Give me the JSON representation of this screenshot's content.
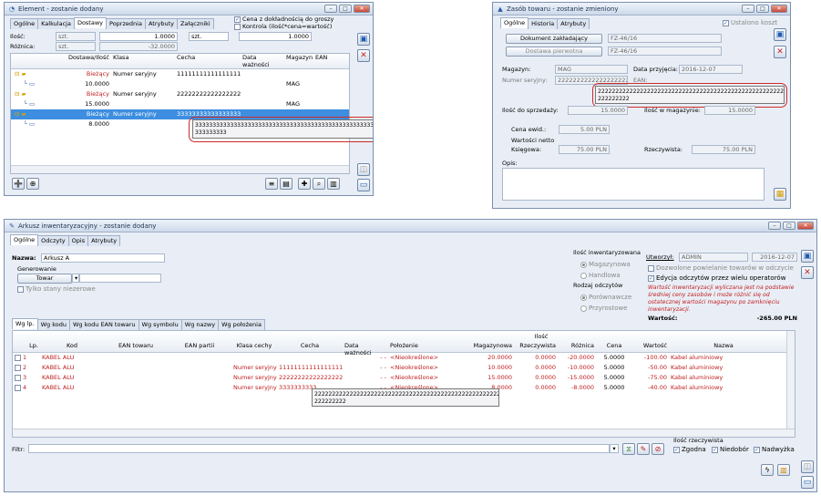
{
  "w1": {
    "title": "Element - zostanie dodany",
    "tabs": [
      "Ogólne",
      "Kalkulacja",
      "Dostawy",
      "Poprzednia",
      "Atrybuty",
      "Załączniki"
    ],
    "ilosc_label": "Ilość:",
    "ilosc_unit": "szt.",
    "ilosc_value": "1.0000",
    "ilosc_unit2": "szt.",
    "ilosc_value2": "1.0000",
    "roznica_label": "Różnica:",
    "roznica_unit": "szt.",
    "roznica_value": "-32.0000",
    "chk_cena": "Cena z dokładnością do groszy",
    "chk_kontrola": "Kontrola (ilość*cena=wartość)",
    "cols": [
      "Dostawa/Ilość",
      "Klasa",
      "Cecha",
      "Data ważności",
      "Magazyn",
      "EAN"
    ],
    "rows": [
      {
        "a": "Bieżący",
        "klasa": "Numer seryjny",
        "cecha": "1111111111111111111",
        "mag": "",
        "t": "folder"
      },
      {
        "a": "10.0000",
        "klasa": "",
        "cecha": "",
        "mag": "MAG",
        "t": "item"
      },
      {
        "a": "Bieżący",
        "klasa": "Numer seryjny",
        "cecha": "2222222222222222222",
        "mag": "",
        "t": "folder"
      },
      {
        "a": "15.0000",
        "klasa": "",
        "cecha": "",
        "mag": "MAG",
        "t": "item"
      },
      {
        "a": "Bieżący",
        "klasa": "Numer seryjny",
        "cecha": "3333333333333333333",
        "mag": "",
        "t": "folder",
        "sel": true
      },
      {
        "a": "8.0000",
        "klasa": "",
        "cecha": "",
        "mag": "",
        "t": "item"
      }
    ],
    "tooltip": "333333333333333333333333333333333333333333333333333333\n333333333"
  },
  "w2": {
    "title": "Zasób towaru - zostanie zmieniony",
    "tabs": [
      "Ogólne",
      "Historia",
      "Atrybuty"
    ],
    "ustalono": "Ustalono koszt",
    "dok_zakl": "Dokument zakładający",
    "dok_zakl_val": "FZ-46/16",
    "dost_pierw": "Dostawa pierwotna",
    "dost_pierw_val": "FZ-46/16",
    "magazyn_label": "Magazyn:",
    "magazyn_val": "MAG",
    "data_label": "Data przyjęcia:",
    "data_val": "2016-12-07",
    "numer_label": "Numer seryjny:",
    "numer_val": "2222222222222222222",
    "ean_label": "EAN:",
    "tooltip": "22222222222222222222222222222222222222222222222222222\n222222222",
    "ilosc_sprz_label": "Ilość do sprzedaży:",
    "ilosc_sprz_val": "15.0000",
    "ilosc_mag_label": "Ilość w magazynie:",
    "ilosc_mag_val": "15.0000",
    "cena_label": "Cena ewid.:",
    "cena_val": "5.00 PLN",
    "wartosci_label": "Wartości netto",
    "ksiegowa_label": "Księgowa:",
    "ksiegowa_val": "75.00 PLN",
    "rzecz_label": "Rzeczywista:",
    "rzecz_val": "75.00 PLN",
    "opis_label": "Opis:"
  },
  "w3": {
    "title": "Arkusz inwentaryzacyjny - zostanie dodany",
    "tabs": [
      "Ogólne",
      "Odczyty",
      "Opis",
      "Atrybuty"
    ],
    "nazwa_label": "Nazwa:",
    "nazwa_val": "Arkusz A",
    "generowanie": "Generowanie",
    "towar": "Towar",
    "tylko": "Tylko stany niezerowe",
    "ilosc_inw": "Ilość inwentaryzowana",
    "magazynowa": "Magazynowa",
    "handlowa": "Handlowa",
    "rodzaj": "Rodzaj odczytów",
    "porownawcze": "Porównawcze",
    "przyrostowe": "Przyrostowe",
    "utworzyl_label": "Utworzył:",
    "utworzyl_val": "ADMIN",
    "utworzyl_date": "2016-12-07",
    "dozwolone": "Dozwolone powielanie towarów w odczycie",
    "edycja": "Edycja odczytów przez wielu operatorów",
    "note": "Wartość inwentaryzacji wyliczana jest na podstawie średniej ceny zasobów i może różnić się od ostatecznej wartości magazynu po zamknięciu inwentaryzacji.",
    "wartosc_label": "Wartość:",
    "wartosc_val": "-265.00 PLN",
    "subtabs": [
      "Wg lp.",
      "Wg kodu",
      "Wg kodu EAN towaru",
      "Wg symbolu",
      "Wg nazwy",
      "Wg położenia"
    ],
    "ilosc_group": "Ilość",
    "cols": [
      "Lp.",
      "Kod",
      "EAN towaru",
      "EAN partii",
      "Klasa cechy",
      "Cecha",
      "Data ważności",
      "Położenie",
      "Magazynowa",
      "Rzeczywista",
      "Różnica",
      "Cena",
      "Wartość",
      "Nazwa"
    ],
    "rows": [
      {
        "lp": "1",
        "kod": "KABEL ALU",
        "klasa": "",
        "cecha": "",
        "data": "- -",
        "pol": "<Nieokreślone>",
        "mag": "20.0000",
        "rz": "0.0000",
        "roz": "-20.0000",
        "cena": "5.0000",
        "wart": "-100.00",
        "nazwa": "Kabel aluminiowy"
      },
      {
        "lp": "2",
        "kod": "KABEL ALU",
        "klasa": "Numer seryjny",
        "cecha": "1111111111111111111",
        "data": "- -",
        "pol": "<Nieokreślone>",
        "mag": "10.0000",
        "rz": "0.0000",
        "roz": "-10.0000",
        "cena": "5.0000",
        "wart": "-50.00",
        "nazwa": "Kabel aluminiowy"
      },
      {
        "lp": "3",
        "kod": "KABEL ALU",
        "klasa": "Numer seryjny",
        "cecha": "2222222222222222222",
        "data": "- -",
        "pol": "<Nieokreślone>",
        "mag": "15.0000",
        "rz": "0.0000",
        "roz": "-15.0000",
        "cena": "5.0000",
        "wart": "-75.00",
        "nazwa": "Kabel aluminiowy"
      },
      {
        "lp": "4",
        "kod": "KABEL ALU",
        "klasa": "Numer seryjny",
        "cecha": "3333333333",
        "data": "- -",
        "pol": "<Nieokreślone>",
        "mag": "8.0000",
        "rz": "0.0000",
        "roz": "-8.0000",
        "cena": "5.0000",
        "wart": "-40.00",
        "nazwa": "Kabel aluminiowy"
      }
    ],
    "tooltip": "22222222222222222222222222222222222222222222222222222\n222222222",
    "filtr_label": "Filtr:",
    "ilosc_rz": "Ilość rzeczywista",
    "zgodna": "Zgodna",
    "niedobor": "Niedobór",
    "nadwyzka": "Nadwyżka"
  }
}
